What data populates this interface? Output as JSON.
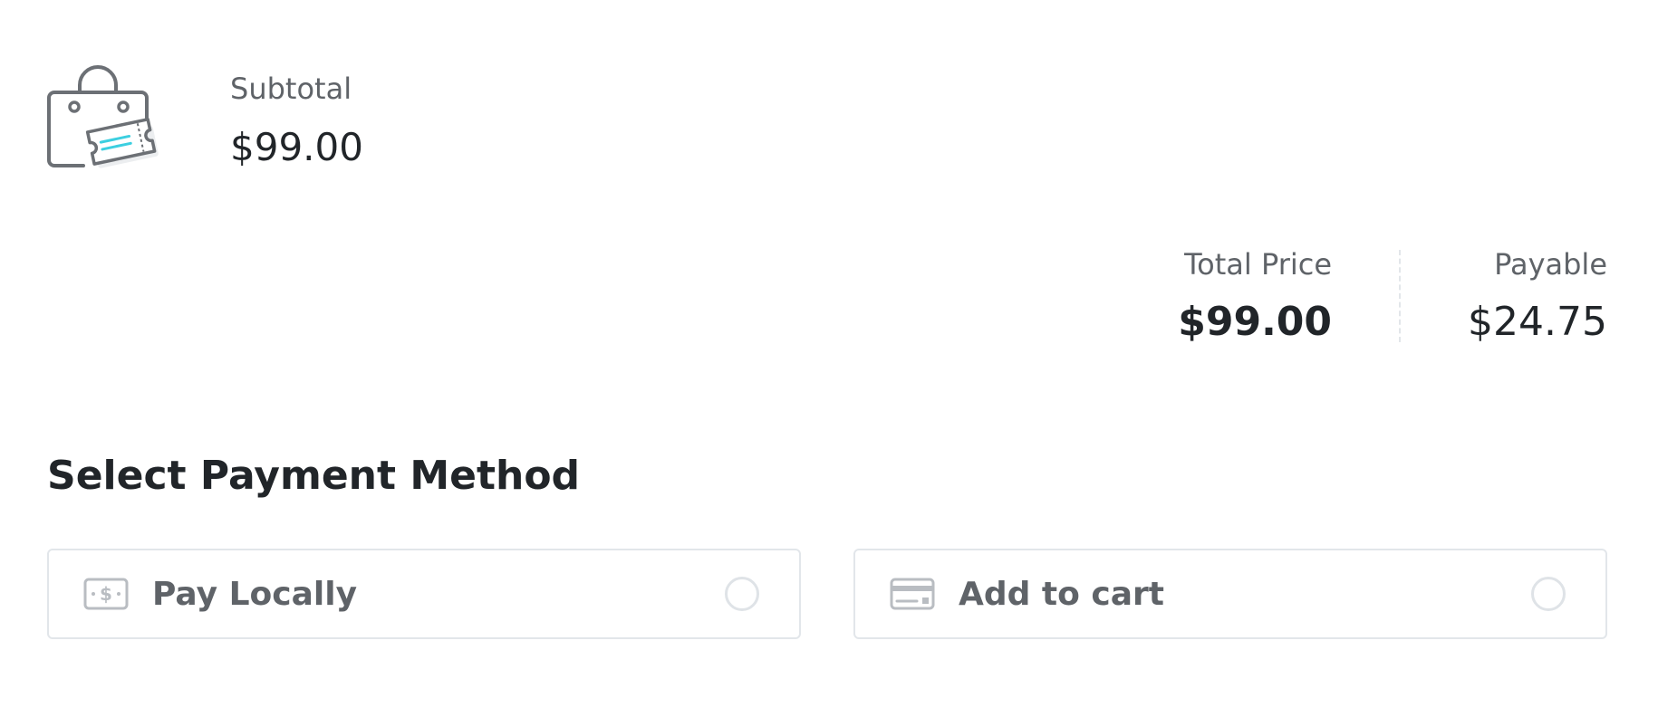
{
  "summary": {
    "icon": "shopping-bag-ticket-icon",
    "subtotal_label": "Subtotal",
    "subtotal_value": "$99.00"
  },
  "totals": {
    "total_price_label": "Total Price",
    "total_price_value": "$99.00",
    "payable_label": "Payable",
    "payable_value": "$24.75"
  },
  "payment": {
    "title": "Select Payment Method",
    "methods": [
      {
        "label": "Pay Locally",
        "icon": "cash-icon",
        "selected": false
      },
      {
        "label": "Add to cart",
        "icon": "credit-card-icon",
        "selected": false
      }
    ]
  },
  "colors": {
    "accent": "#3ccfe0",
    "icon_gray": "#6c7075",
    "border": "#e2e6ea",
    "text_dark": "#212529",
    "text_muted": "#5f6368"
  }
}
